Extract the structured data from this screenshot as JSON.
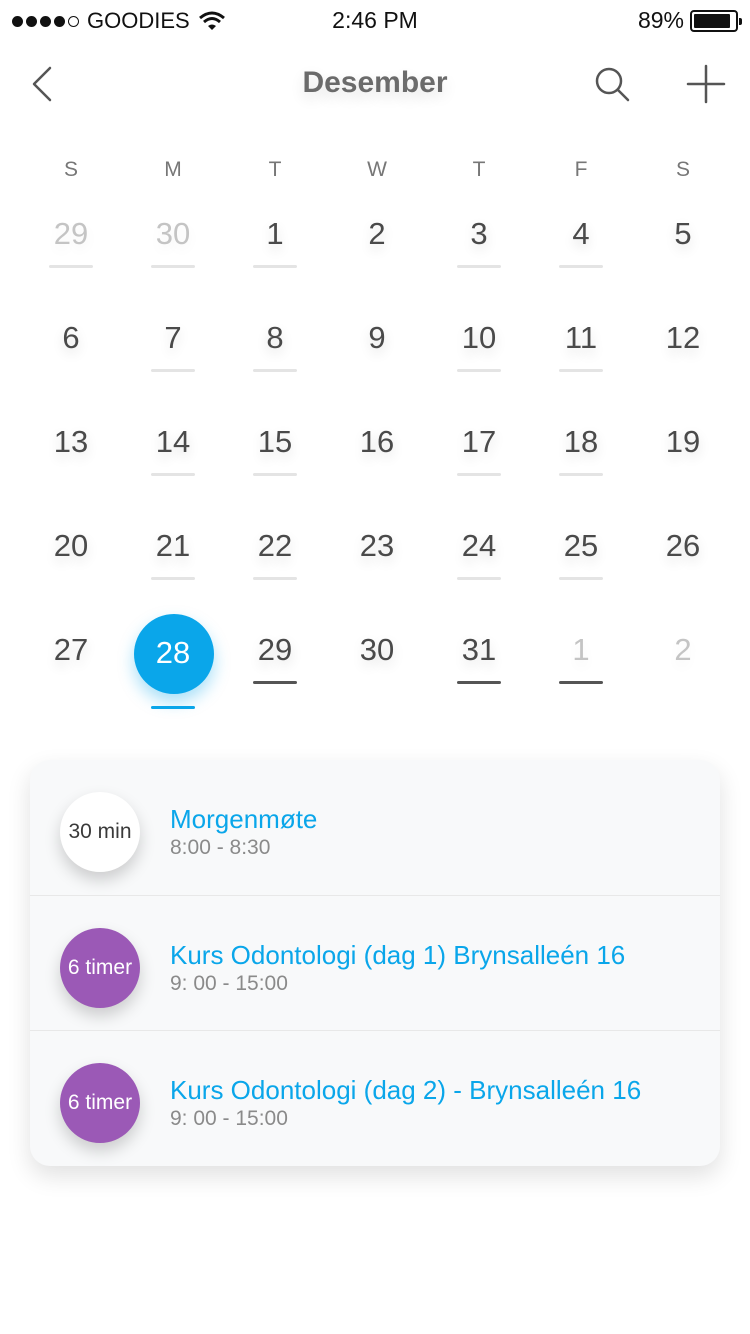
{
  "status_bar": {
    "carrier": "GOODIES",
    "time": "2:46 PM",
    "battery_percent": "89%",
    "battery_level": 0.89,
    "signal_bars": 4,
    "signal_max": 5
  },
  "header": {
    "month": "Desember",
    "back_icon": "chevron-left-icon",
    "search_icon": "search-icon",
    "add_icon": "plus-icon"
  },
  "calendar": {
    "weekdays": [
      "S",
      "M",
      "T",
      "W",
      "T",
      "F",
      "S"
    ],
    "weeks": [
      [
        {
          "d": "29",
          "muted": true,
          "ev": "light"
        },
        {
          "d": "30",
          "muted": true,
          "ev": "light"
        },
        {
          "d": "1",
          "ev": "light"
        },
        {
          "d": "2"
        },
        {
          "d": "3",
          "ev": "light"
        },
        {
          "d": "4",
          "ev": "light"
        },
        {
          "d": "5"
        }
      ],
      [
        {
          "d": "6"
        },
        {
          "d": "7",
          "ev": "light"
        },
        {
          "d": "8",
          "ev": "light"
        },
        {
          "d": "9"
        },
        {
          "d": "10",
          "ev": "light"
        },
        {
          "d": "11",
          "ev": "light"
        },
        {
          "d": "12"
        }
      ],
      [
        {
          "d": "13"
        },
        {
          "d": "14",
          "ev": "light"
        },
        {
          "d": "15",
          "ev": "light"
        },
        {
          "d": "16"
        },
        {
          "d": "17",
          "ev": "light"
        },
        {
          "d": "18",
          "ev": "light"
        },
        {
          "d": "19"
        }
      ],
      [
        {
          "d": "20"
        },
        {
          "d": "21",
          "ev": "light"
        },
        {
          "d": "22",
          "ev": "light"
        },
        {
          "d": "23"
        },
        {
          "d": "24",
          "ev": "light"
        },
        {
          "d": "25",
          "ev": "light"
        },
        {
          "d": "26"
        }
      ],
      [
        {
          "d": "27"
        },
        {
          "d": "28",
          "selected": true,
          "ev": "accent"
        },
        {
          "d": "29",
          "ev": "strong"
        },
        {
          "d": "30"
        },
        {
          "d": "31",
          "ev": "strong"
        },
        {
          "d": "1",
          "muted": true,
          "ev": "strong"
        },
        {
          "d": "2",
          "muted": true
        }
      ]
    ]
  },
  "events": [
    {
      "duration": "30 min",
      "title": "Morgenmøte",
      "time": "8:00 - 8:30",
      "badge_color": "#ffffff",
      "badge_text_color": "#3a3a3a"
    },
    {
      "duration": "6 timer",
      "title": "Kurs Odontologi (dag 1) Brynsalleén 16",
      "time": "9: 00 - 15:00",
      "badge_color": "#9b59b6",
      "badge_text_color": "#ffffff"
    },
    {
      "duration": "6 timer",
      "title": "Kurs Odontologi (dag 2) - Brynsalleén 16",
      "time": "9: 00 - 15:00",
      "badge_color": "#9b59b6",
      "badge_text_color": "#ffffff"
    }
  ],
  "colors": {
    "accent": "#0aa6ea",
    "purple": "#9b59b6"
  }
}
